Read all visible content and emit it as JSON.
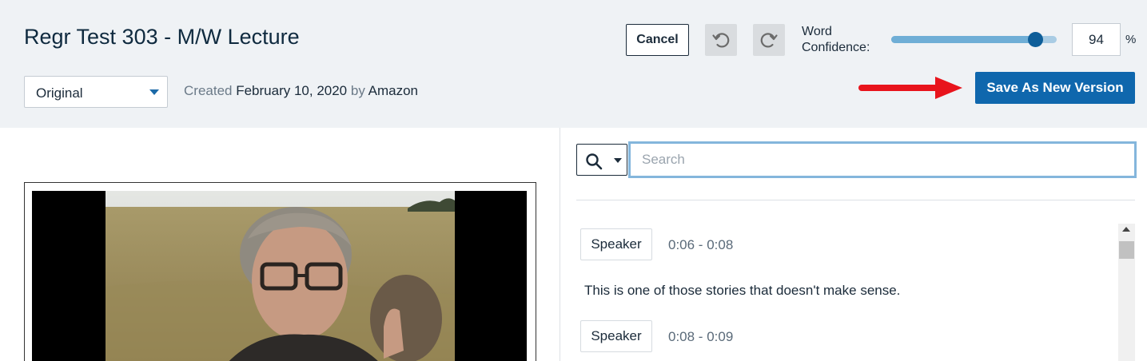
{
  "header": {
    "title": "Regr Test 303 - M/W Lecture",
    "version_select": {
      "selected": "Original"
    },
    "created": {
      "prefix": "Created",
      "date": "February 10, 2020",
      "by_word": "by",
      "author": "Amazon"
    },
    "cancel_label": "Cancel",
    "word_confidence": {
      "label": "Word Confidence:",
      "value": "94",
      "unit": "%",
      "slider_fraction": 0.87
    },
    "save_label": "Save As New Version",
    "accent_color": "#0f67ad",
    "arrow_color": "#e8141c"
  },
  "search": {
    "type_icon": "search-icon",
    "placeholder": "Search"
  },
  "transcript": {
    "segments": [
      {
        "speaker": "Speaker",
        "time": "0:06 - 0:08",
        "text": "This is one of those stories that doesn't make sense."
      },
      {
        "speaker": "Speaker",
        "time": "0:08 - 0:09",
        "text": ""
      }
    ]
  }
}
